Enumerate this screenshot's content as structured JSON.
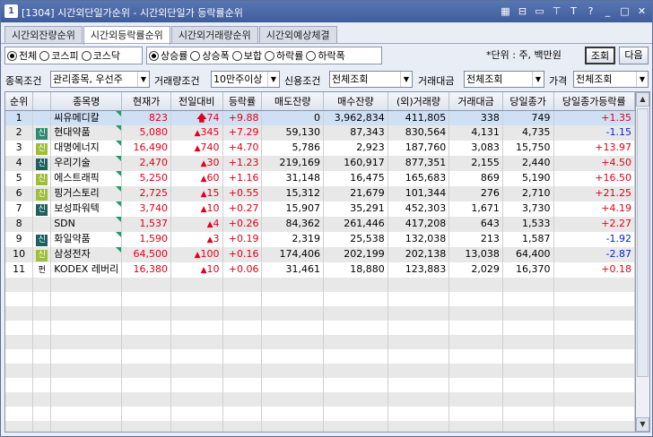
{
  "title": {
    "num": "1",
    "text": "[1304] 시간외단일가순위 - 시간외단일가 등락률순위"
  },
  "title_icons": [
    "calendar-icon",
    "lock-icon",
    "window-icon",
    "pin-icon",
    "text-icon",
    "help-icon",
    "minimize-icon",
    "maximize-icon",
    "close-icon"
  ],
  "title_icon_glyphs": [
    "▦",
    "⊟",
    "▭",
    "⊤",
    "T",
    "?",
    "_",
    "□",
    "✕"
  ],
  "tabs": [
    {
      "label": "시간외잔량순위",
      "active": false
    },
    {
      "label": "시간외등락률순위",
      "active": true
    },
    {
      "label": "시간외거래량순위",
      "active": false
    },
    {
      "label": "시간외예상체결",
      "active": false
    }
  ],
  "unit_label": "*단위 : 주, 백만원",
  "buttons": {
    "search": "조회",
    "next": "다음"
  },
  "market_radios": [
    {
      "label": "전체",
      "on": true
    },
    {
      "label": "코스피",
      "on": false
    },
    {
      "label": "코스닥",
      "on": false
    }
  ],
  "rank_radios": [
    {
      "label": "상승률",
      "on": true
    },
    {
      "label": "상승폭",
      "on": false
    },
    {
      "label": "보합",
      "on": false
    },
    {
      "label": "하락률",
      "on": false
    },
    {
      "label": "하락폭",
      "on": false
    }
  ],
  "filters": {
    "item_cond_label": "종목조건",
    "item_cond_value": "관리종목, 우선주",
    "volume_cond_label": "거래량조건",
    "volume_cond_value": "10만주이상",
    "credit_cond_label": "신용조건",
    "credit_cond_value": "전체조회",
    "amount_label": "거래대금",
    "amount_value": "전체조회",
    "price_label": "가격",
    "price_value": "전체조회"
  },
  "columns": [
    "순위",
    "",
    "종목명",
    "현재가",
    "전일대비",
    "등락률",
    "매도잔량",
    "매수잔량",
    "(외)거래량",
    "거래대금",
    "당일종가",
    "당일종가등락률"
  ],
  "rows": [
    {
      "rank": "1",
      "mark": "",
      "name": "씨유메디칼",
      "price": "823",
      "chg": "74",
      "rate": "+9.88",
      "ask": "0",
      "bid": "3,962,834",
      "vol": "411,805",
      "amt": "338",
      "close": "749",
      "close_rate": "+1.35",
      "limit": true
    },
    {
      "rank": "2",
      "mark": "신",
      "name": "현대약품",
      "price": "5,080",
      "chg": "345",
      "rate": "+7.29",
      "ask": "59,130",
      "bid": "87,343",
      "vol": "830,564",
      "amt": "4,131",
      "close": "4,735",
      "close_rate": "-1.15",
      "limit": false
    },
    {
      "rank": "3",
      "mark": "신",
      "name": "대명에너지",
      "price": "16,490",
      "chg": "740",
      "rate": "+4.70",
      "ask": "5,786",
      "bid": "2,923",
      "vol": "187,760",
      "amt": "3,083",
      "close": "15,750",
      "close_rate": "+13.97",
      "limit": false
    },
    {
      "rank": "4",
      "mark": "신",
      "name": "우리기술",
      "price": "2,470",
      "chg": "30",
      "rate": "+1.23",
      "ask": "219,169",
      "bid": "160,917",
      "vol": "877,351",
      "amt": "2,155",
      "close": "2,440",
      "close_rate": "+4.50",
      "limit": false
    },
    {
      "rank": "5",
      "mark": "신",
      "name": "에스트래픽",
      "price": "5,250",
      "chg": "60",
      "rate": "+1.16",
      "ask": "31,148",
      "bid": "16,475",
      "vol": "165,683",
      "amt": "869",
      "close": "5,190",
      "close_rate": "+16.50",
      "limit": false
    },
    {
      "rank": "6",
      "mark": "신",
      "name": "핑거스토리",
      "price": "2,725",
      "chg": "15",
      "rate": "+0.55",
      "ask": "15,312",
      "bid": "21,679",
      "vol": "101,344",
      "amt": "276",
      "close": "2,710",
      "close_rate": "+21.25",
      "limit": false
    },
    {
      "rank": "7",
      "mark": "신",
      "name": "보성파워텍",
      "price": "3,740",
      "chg": "10",
      "rate": "+0.27",
      "ask": "15,907",
      "bid": "35,291",
      "vol": "452,303",
      "amt": "1,671",
      "close": "3,730",
      "close_rate": "+4.19",
      "limit": false
    },
    {
      "rank": "8",
      "mark": "",
      "name": "SDN",
      "price": "1,537",
      "chg": "4",
      "rate": "+0.26",
      "ask": "84,362",
      "bid": "261,446",
      "vol": "417,208",
      "amt": "643",
      "close": "1,533",
      "close_rate": "+2.27",
      "limit": false
    },
    {
      "rank": "9",
      "mark": "신",
      "name": "화일약품",
      "price": "1,590",
      "chg": "3",
      "rate": "+0.19",
      "ask": "2,319",
      "bid": "25,538",
      "vol": "132,038",
      "amt": "213",
      "close": "1,587",
      "close_rate": "-1.92",
      "limit": false
    },
    {
      "rank": "10",
      "mark": "신",
      "name": "삼성전자",
      "price": "64,500",
      "chg": "100",
      "rate": "+0.16",
      "ask": "174,406",
      "bid": "202,199",
      "vol": "202,138",
      "amt": "13,038",
      "close": "64,400",
      "close_rate": "-2.87",
      "limit": false
    },
    {
      "rank": "11",
      "mark": "펀",
      "name": "KODEX 레버리",
      "price": "16,380",
      "chg": "10",
      "rate": "+0.06",
      "ask": "31,461",
      "bid": "18,880",
      "vol": "123,883",
      "amt": "2,029",
      "close": "16,370",
      "close_rate": "+0.18",
      "limit": false
    }
  ],
  "colors": {
    "up": "#e2001a",
    "down": "#0026d9",
    "title_bar": "#4a68a8",
    "selected_row": "#cfe0f4"
  }
}
